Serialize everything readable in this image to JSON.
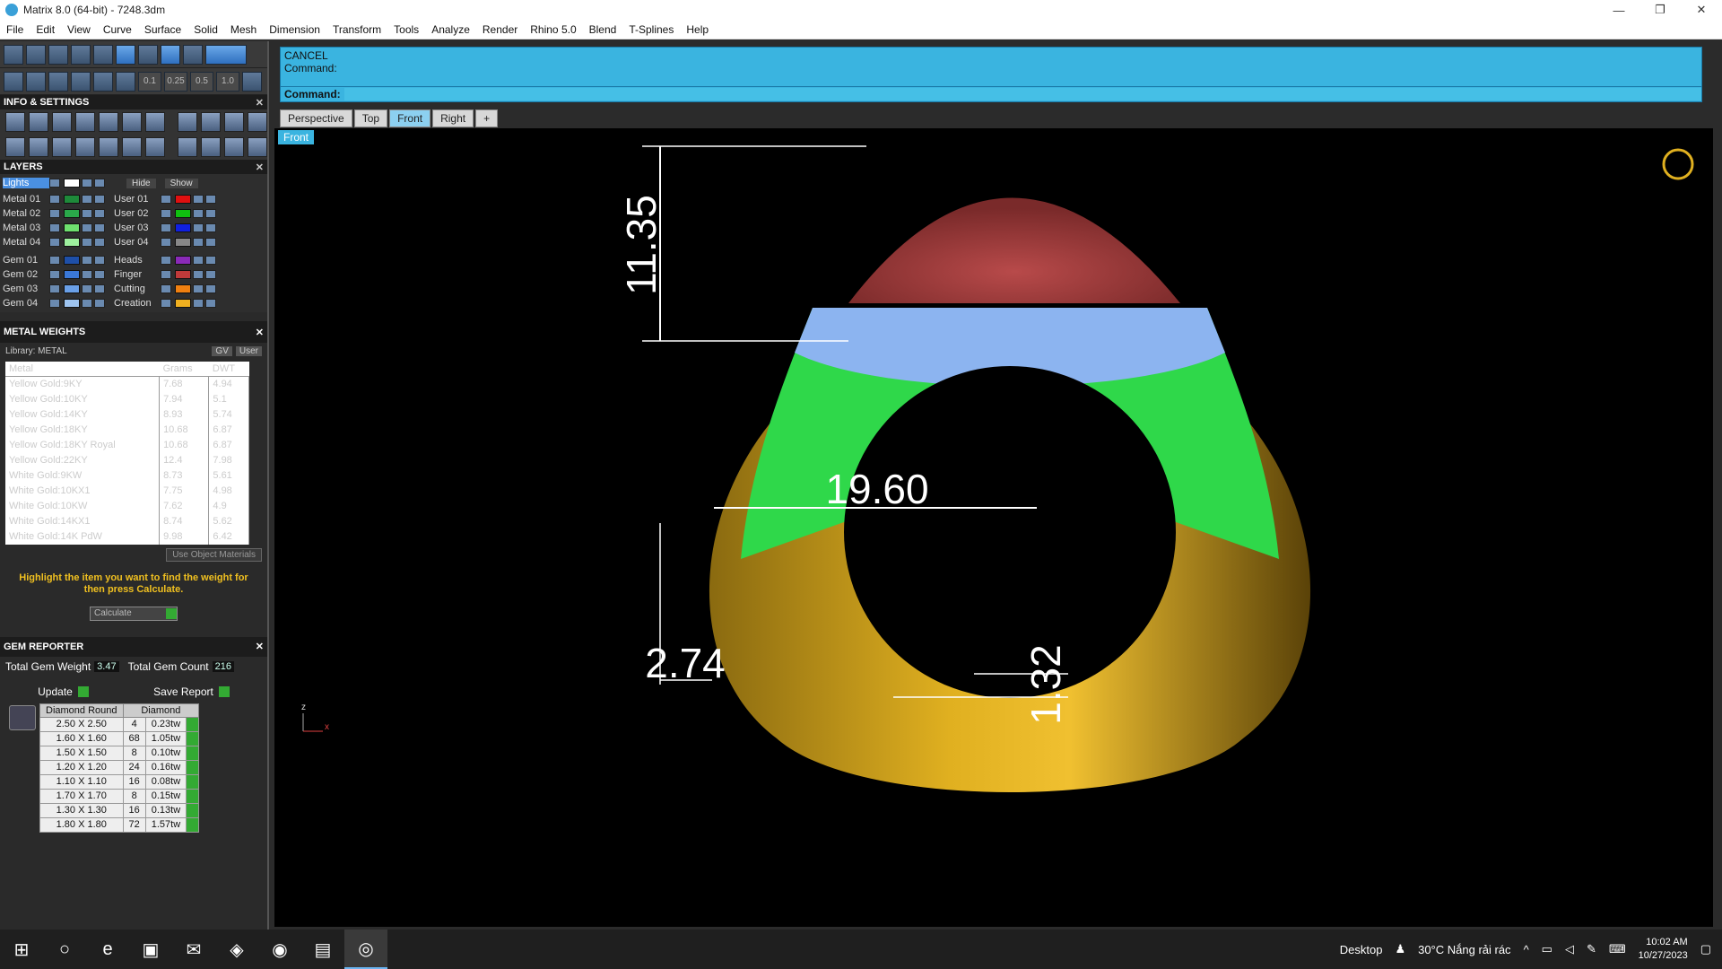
{
  "window": {
    "title": "Matrix 8.0 (64-bit) - 7248.3dm",
    "min": "—",
    "restore": "❐",
    "close": "✕"
  },
  "menu": [
    "File",
    "Edit",
    "View",
    "Curve",
    "Surface",
    "Solid",
    "Mesh",
    "Dimension",
    "Transform",
    "Tools",
    "Analyze",
    "Render",
    "Rhino 5.0",
    "Blend",
    "T-Splines",
    "Help"
  ],
  "snap_values": [
    "0.1",
    "0.25",
    "0.5",
    "1.0"
  ],
  "info_settings": {
    "title": "INFO & SETTINGS",
    "close": "✕"
  },
  "layers": {
    "title": "LAYERS",
    "close": "✕",
    "lights_label": "Lights",
    "hide_label": "Hide",
    "show_label": "Show",
    "left_col": [
      {
        "name": "Metal 01",
        "color": "#1e8a3a"
      },
      {
        "name": "Metal 02",
        "color": "#2aa84a"
      },
      {
        "name": "Metal 03",
        "color": "#6ee06e"
      },
      {
        "name": "Metal 04",
        "color": "#9ef09e"
      },
      {
        "name": "Gem 01",
        "color": "#1e4fa8"
      },
      {
        "name": "Gem 02",
        "color": "#3a78d8"
      },
      {
        "name": "Gem 03",
        "color": "#6aa0e8"
      },
      {
        "name": "Gem 04",
        "color": "#9ec4f0"
      }
    ],
    "right_col": [
      {
        "name": "User 01",
        "color": "#e01010"
      },
      {
        "name": "User 02",
        "color": "#10c010"
      },
      {
        "name": "User 03",
        "color": "#1020e0"
      },
      {
        "name": "User 04",
        "color": "#888888"
      },
      {
        "name": "Heads",
        "color": "#8a2ab8"
      },
      {
        "name": "Finger",
        "color": "#c03a3a"
      },
      {
        "name": "Cutting",
        "color": "#f08010"
      },
      {
        "name": "Creation",
        "color": "#f0b020"
      }
    ]
  },
  "metal_weights": {
    "title": "METAL WEIGHTS",
    "close": "✕",
    "library": "Library: METAL",
    "gv_label": "GV",
    "user_label": "User",
    "headers": [
      "Metal",
      "Grams",
      "DWT"
    ],
    "rows": [
      [
        "Yellow Gold:9KY",
        "7.68",
        "4.94"
      ],
      [
        "Yellow Gold:10KY",
        "7.94",
        "5.1"
      ],
      [
        "Yellow Gold:14KY",
        "8.93",
        "5.74"
      ],
      [
        "Yellow Gold:18KY",
        "10.68",
        "6.87"
      ],
      [
        "Yellow Gold:18KY Royal",
        "10.68",
        "6.87"
      ],
      [
        "Yellow Gold:22KY",
        "12.4",
        "7.98"
      ],
      [
        "White Gold:9KW",
        "8.73",
        "5.61"
      ],
      [
        "White Gold:10KX1",
        "7.75",
        "4.98"
      ],
      [
        "White Gold:10KW",
        "7.62",
        "4.9"
      ],
      [
        "White Gold:14KX1",
        "8.74",
        "5.62"
      ],
      [
        "White Gold:14K PdW",
        "9.98",
        "6.42"
      ]
    ],
    "use_object_materials": "Use Object Materials",
    "hint": "Highlight the item you want to find the weight for then press Calculate.",
    "calculate": "Calculate"
  },
  "gem_reporter": {
    "title": "GEM REPORTER",
    "close": "✕",
    "total_weight_label": "Total Gem Weight",
    "total_weight": "3.47",
    "total_count_label": "Total Gem Count",
    "total_count": "216",
    "update": "Update",
    "save_report": "Save Report",
    "headers": [
      "Diamond Round",
      "Diamond"
    ],
    "rows": [
      [
        "2.50 X 2.50",
        "4",
        "0.23tw"
      ],
      [
        "1.60 X 1.60",
        "68",
        "1.05tw"
      ],
      [
        "1.50 X 1.50",
        "8",
        "0.10tw"
      ],
      [
        "1.20 X 1.20",
        "24",
        "0.16tw"
      ],
      [
        "1.10 X 1.10",
        "16",
        "0.08tw"
      ],
      [
        "1.70 X 1.70",
        "8",
        "0.15tw"
      ],
      [
        "1.30 X 1.30",
        "16",
        "0.13tw"
      ],
      [
        "1.80 X 1.80",
        "72",
        "1.57tw"
      ]
    ]
  },
  "command": {
    "history_1": "CANCEL",
    "history_2": "Command:",
    "prompt": "Command:"
  },
  "tabs": [
    "Perspective",
    "Top",
    "Front",
    "Right",
    "+"
  ],
  "viewport": {
    "label": "Front",
    "dim_height": "11.35",
    "dim_width": "19.60",
    "dim_shank": "2.74",
    "dim_thickness": "1.32",
    "axis_z": "z",
    "axis_x": "x"
  },
  "taskbar": {
    "desktop": "Desktop",
    "weather": "30°C  Nắng rải rác",
    "time": "10:02 AM",
    "date": "10/27/2023"
  }
}
